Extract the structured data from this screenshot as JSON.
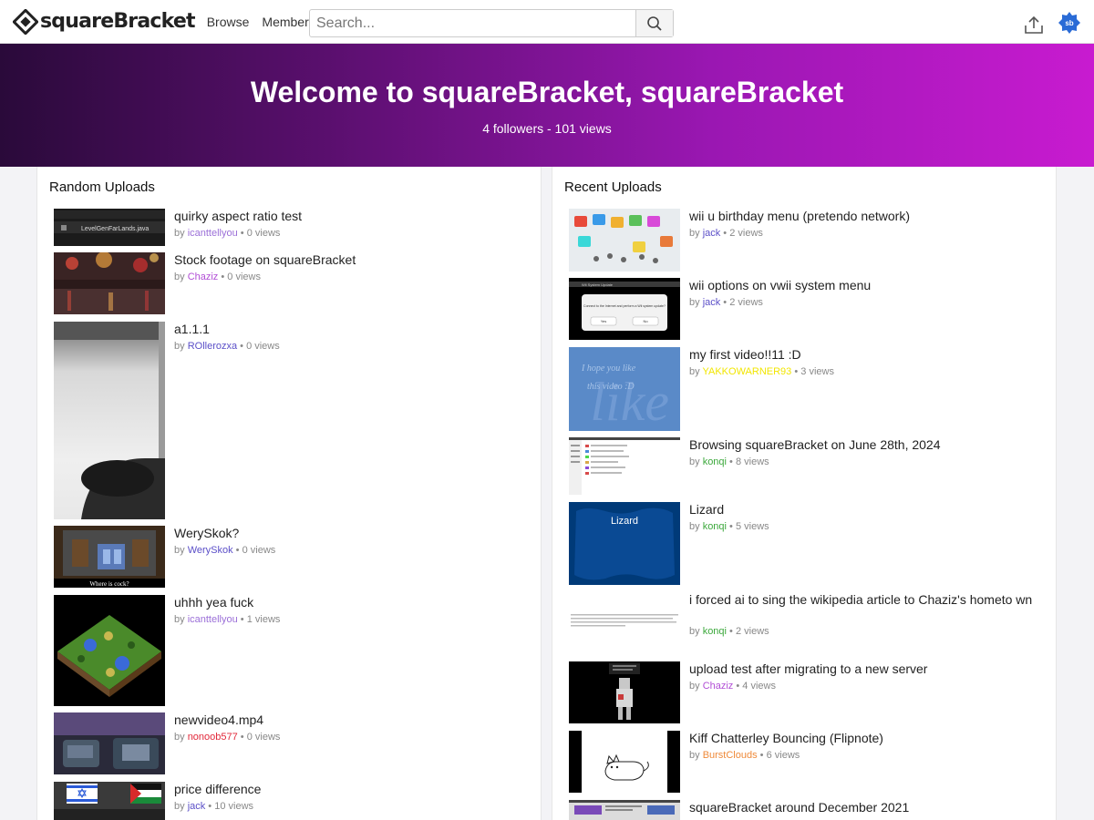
{
  "header": {
    "logo_text": "squareBracket",
    "nav": [
      "Browse",
      "Members"
    ],
    "search_placeholder": "Search..."
  },
  "banner": {
    "title": "Welcome to squareBracket, squareBracket",
    "stats": "4 followers - 101 views"
  },
  "random_uploads": {
    "title": "Random Uploads",
    "items": [
      {
        "title": "quirky aspect ratio test",
        "by": "by",
        "author": "icanttellyou",
        "author_color": "#9b6fd8",
        "views": "0 views"
      },
      {
        "title": "Stock footage on squareBracket",
        "by": "by",
        "author": "Chaziz",
        "author_color": "#b24fd6",
        "views": "0 views"
      },
      {
        "title": "a1.1.1",
        "by": "by",
        "author": "ROllerozxa",
        "author_color": "#5b4fc8",
        "views": "0 views"
      },
      {
        "title": "WerySkok?",
        "by": "by",
        "author": "WerySkok",
        "author_color": "#5b4fc8",
        "views": "0 views"
      },
      {
        "title": "uhhh yea fuck",
        "by": "by",
        "author": "icanttellyou",
        "author_color": "#9b6fd8",
        "views": "1 views"
      },
      {
        "title": "newvideo4.mp4",
        "by": "by",
        "author": "nonoob577",
        "author_color": "#e2283a",
        "views": "0 views"
      },
      {
        "title": "price difference",
        "by": "by",
        "author": "jack",
        "author_color": "#5b4fc8",
        "views": "10 views"
      }
    ]
  },
  "recent_uploads": {
    "title": "Recent Uploads",
    "items": [
      {
        "title": "wii u birthday menu (pretendo network)",
        "by": "by",
        "author": "jack",
        "author_color": "#5b4fc8",
        "views": "2 views"
      },
      {
        "title": "wii options on vwii system menu",
        "by": "by",
        "author": "jack",
        "author_color": "#5b4fc8",
        "views": "2 views"
      },
      {
        "title": "my first video!!11 :D",
        "by": "by",
        "author": "YAKKOWARNER93",
        "author_color": "#f2e600",
        "views": "3 views"
      },
      {
        "title": "Browsing squareBracket on June 28th, 2024",
        "by": "by",
        "author": "konqi",
        "author_color": "#3ba83b",
        "views": "8 views"
      },
      {
        "title": "Lizard",
        "by": "by",
        "author": "konqi",
        "author_color": "#3ba83b",
        "views": "5 views"
      },
      {
        "title": "i forced ai to sing the wikipedia article to Chaziz's hometo wn",
        "by": "by",
        "author": "konqi",
        "author_color": "#3ba83b",
        "views": "2 views"
      },
      {
        "title": "upload test after migrating to a new server",
        "by": "by",
        "author": "Chaziz",
        "author_color": "#b24fd6",
        "views": "4 views"
      },
      {
        "title": "Kiff Chatterley Bouncing (Flipnote)",
        "by": "by",
        "author": "BurstClouds",
        "author_color": "#ef8a3a",
        "views": "6 views"
      },
      {
        "title": "squareBracket around December 2021",
        "by": "by",
        "author": "",
        "author_color": "#5b4fc8",
        "views": ""
      }
    ]
  },
  "thumb_text": {
    "code_file": "LevelGenFarLands.java",
    "minecraft_caption": "Where is cock?",
    "wii_prompt": "Connect to the Internet and perform a Wii system update?",
    "wii_yes": "Yes",
    "wii_no": "No",
    "wii_header": "Wii System Update",
    "handwriting_1": "I hope you like",
    "handwriting_2": "this video :D",
    "lizard": "Lizard"
  },
  "colors": {
    "banner_start": "#2a0a3a",
    "banner_end": "#c81bd0",
    "meta_gray": "#888888"
  },
  "icons": [
    "logo-icon",
    "search-icon",
    "upload-icon",
    "avatar-icon"
  ]
}
